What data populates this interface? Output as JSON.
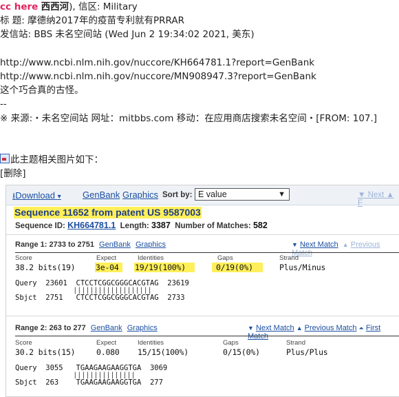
{
  "post": {
    "header_cc": "cc here",
    "header_site": "西西河",
    "header_rest": "), 信区: Military",
    "title_line": "标  题: 摩德纳2017年的疫苗专利就有PRRAR",
    "site_line": "发信站: BBS 未名空间站 (Wed Jun  2 19:34:02 2021, 美东)",
    "url1": "http://www.ncbi.nlm.nih.gov/nuccore/KH664781.1?report=GenBank",
    "url2": "http://www.ncbi.nlm.nih.gov/nuccore/MN908947.3?report=GenBank",
    "comment": "这个巧合真的古怪。",
    "dashes": "--",
    "footer": "※ 来源:・未名空间站 网址：mitbbs.com 移动：在应用商店搜索未名空间・[FROM: 107.]",
    "attach_label": "此主题相关图片如下：",
    "delete_label": "[删除]"
  },
  "panel": {
    "download": "Download",
    "genbank": "GenBank",
    "graphics": "Graphics",
    "sort_label": "Sort by:",
    "sort_value": "E value",
    "next_label": "▼ Next",
    "next_tail": "▲ F",
    "seq_title": "Sequence 11652 from patent US 9587003",
    "seq_id_label": "Sequence ID:",
    "seq_id": "KH664781.1",
    "length_label": "Length:",
    "length": "3387",
    "matches_label": "Number of Matches:",
    "matches": "582"
  },
  "ranges": [
    {
      "title": "Range 1: 2733 to 2751",
      "links": [
        "GenBank",
        "Graphics"
      ],
      "nav": [
        "Next Match",
        "Previous Match"
      ],
      "score": "38.2 bits(19)",
      "expect": "3e-04",
      "identities": "19/19(100%)",
      "gaps": "0/19(0%)",
      "strand": "Plus/Minus",
      "query": "Query  23601  CTCCTCGGCGGGCACGTAG  23619",
      "bars": "              |||||||||||||||||||",
      "sbjct": "Sbjct  2751   CTCCTCGGCGGGCACGTAG  2733"
    },
    {
      "title": "Range 2: 263 to 277",
      "links": [
        "GenBank",
        "Graphics"
      ],
      "nav": [
        "Next Match",
        "Previous Match",
        "First Match"
      ],
      "score": "30.2 bits(15)",
      "expect": "0.080",
      "identities": "15/15(100%)",
      "gaps": "0/15(0%)",
      "strand": "Plus/Plus",
      "query": "Query  3055   TGAAGAAGAAGGTGA  3069",
      "bars": "              |||||||||||||||",
      "sbjct": "Sbjct  263    TGAAGAAGAAGGTGA  277"
    }
  ],
  "stat_labels": [
    "Score",
    "Expect",
    "Identities",
    "Gaps",
    "Strand"
  ]
}
